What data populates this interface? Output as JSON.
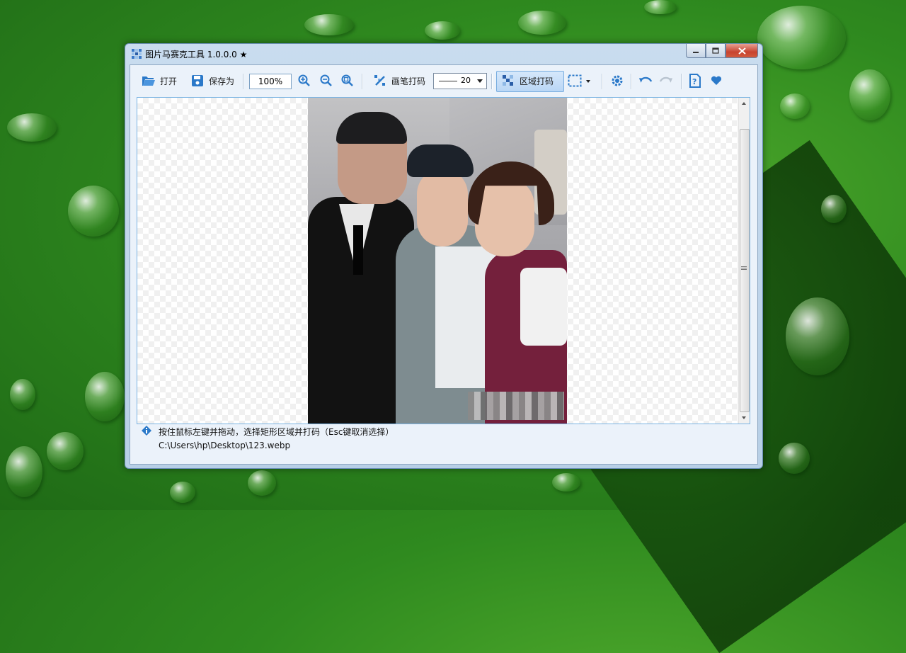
{
  "window": {
    "title": "图片马赛克工具 1.0.0.0 ★"
  },
  "toolbar": {
    "open_label": "打开",
    "save_label": "保存为",
    "zoom_value": "100%",
    "brush_label": "画笔打码",
    "line_width": "20",
    "region_label": "区域打码"
  },
  "status": {
    "hint": "按住鼠标左键并拖动，选择矩形区域并打码（Esc键取消选择）",
    "file_path": "C:\\Users\\hp\\Desktop\\123.webp"
  },
  "colors": {
    "accent": "#2b79c9",
    "title_bar": "#c9dcef",
    "active_tool": "#b9d6f5"
  },
  "icons": [
    "folder-open-icon",
    "save-icon",
    "zoom-in-icon",
    "zoom-out-icon",
    "zoom-fit-icon",
    "brush-icon",
    "region-mosaic-icon",
    "selection-icon",
    "settings-icon",
    "undo-icon",
    "redo-icon",
    "help-icon",
    "heart-icon",
    "info-icon"
  ]
}
